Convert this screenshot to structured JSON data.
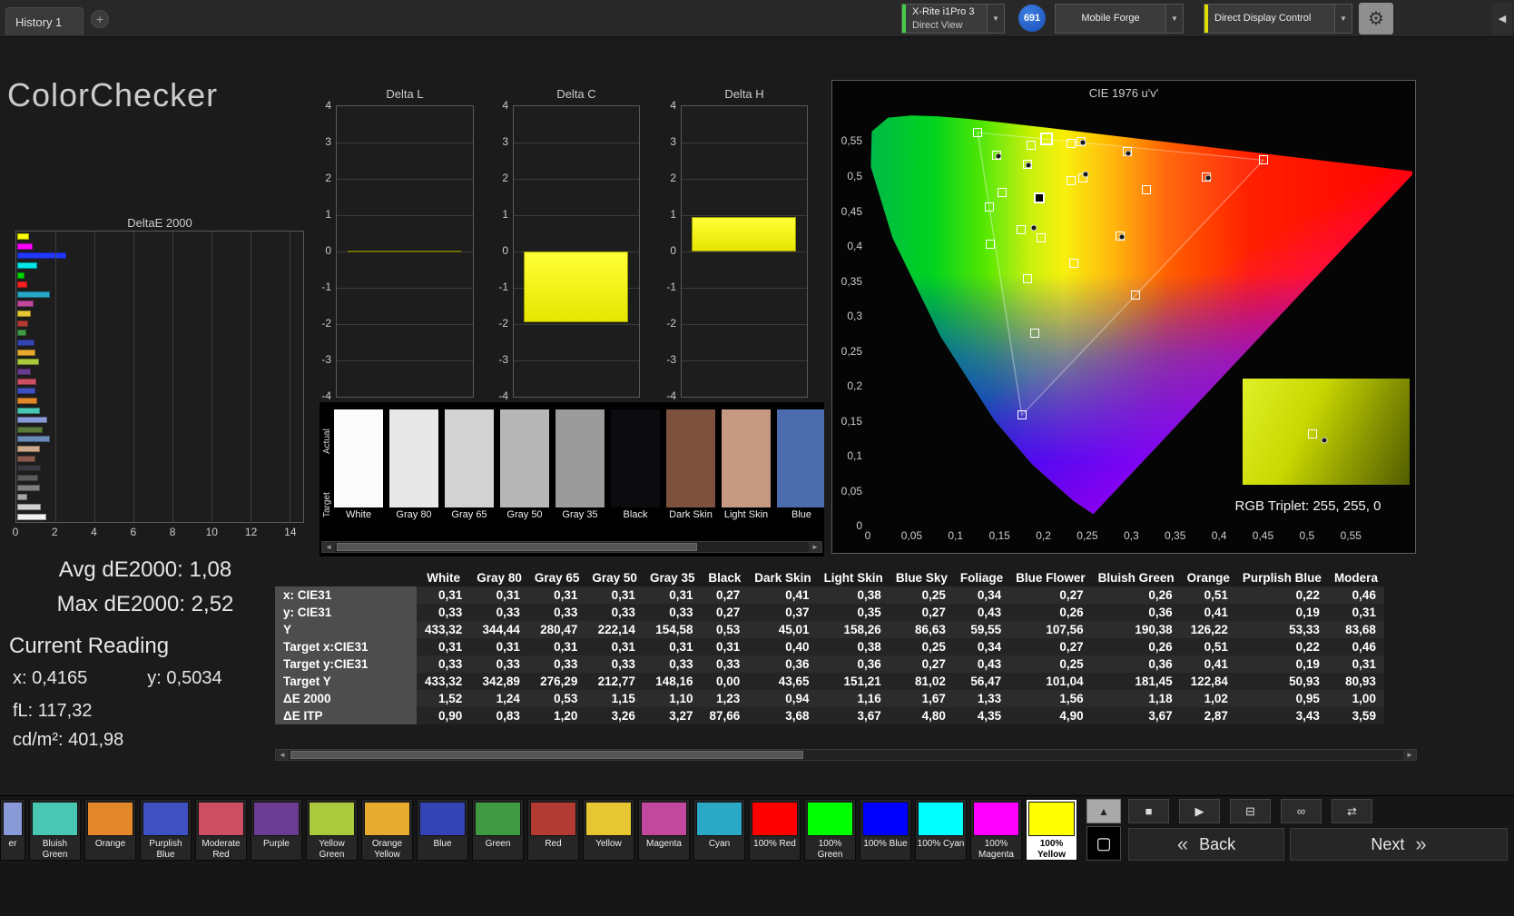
{
  "title": "ColorChecker",
  "icons": {
    "dropdown": "▼",
    "gear": "⚙",
    "collapse": "◀",
    "scroll_left": "◄",
    "scroll_right": "►",
    "up": "▲",
    "stop": "■",
    "play": "▶",
    "pattern": "⊟",
    "infinity": "∞",
    "loop": "⇄",
    "back_chev": "«",
    "next_chev": "»",
    "plus": "+",
    "square": "▢"
  },
  "colors": {
    "accent_green": "#44cc44",
    "accent_yellow": "#dddd00",
    "badge_blue": "#1f62d4",
    "bar_yellow": "#ffff00",
    "selected_patch_bg": "#ffffff"
  },
  "topbar": {
    "tab": "History 1",
    "meter_line1": "X-Rite i1Pro 3",
    "meter_line2": "Direct View",
    "badge": "691",
    "pattern_source": "Mobile Forge",
    "display_control": "Direct Display Control"
  },
  "stats": {
    "avg": "Avg dE2000: 1,08",
    "max": "Max dE2000: 2,52",
    "current": "Current Reading",
    "x": "x: 0,4165",
    "y": "y: 0,5034",
    "fl": "fL: 117,32",
    "cd": "cd/m²: 401,98"
  },
  "deltae_chart": {
    "title": "DeltaE 2000",
    "x_ticks": [
      0,
      2,
      4,
      6,
      8,
      10,
      12,
      14
    ],
    "xmax": 14.7,
    "bars": [
      {
        "c": "#ffff00",
        "v": 0.62
      },
      {
        "c": "#ff00ff",
        "v": 0.8
      },
      {
        "c": "#2038ff",
        "v": 2.52
      },
      {
        "c": "#00e8e8",
        "v": 1.02
      },
      {
        "c": "#00d800",
        "v": 0.38
      },
      {
        "c": "#ff2020",
        "v": 0.52
      },
      {
        "c": "#28a8c8",
        "v": 1.7
      },
      {
        "c": "#c2489e",
        "v": 0.85
      },
      {
        "c": "#e6c732",
        "v": 0.72
      },
      {
        "c": "#b23c34",
        "v": 0.58
      },
      {
        "c": "#3f9a43",
        "v": 0.48
      },
      {
        "c": "#3444b4",
        "v": 0.88
      },
      {
        "c": "#e7ab2f",
        "v": 0.95
      },
      {
        "c": "#abc93c",
        "v": 1.12
      },
      {
        "c": "#6b3d92",
        "v": 0.68
      },
      {
        "c": "#cc4f63",
        "v": 1.0
      },
      {
        "c": "#3f51c1",
        "v": 0.95
      },
      {
        "c": "#e2882a",
        "v": 1.02
      },
      {
        "c": "#49c7b2",
        "v": 1.18
      },
      {
        "c": "#8a9ad8",
        "v": 1.56
      },
      {
        "c": "#5a7a3a",
        "v": 1.33
      },
      {
        "c": "#6a8ab8",
        "v": 1.67
      },
      {
        "c": "#d0a98a",
        "v": 1.16
      },
      {
        "c": "#8a5a4a",
        "v": 0.94
      },
      {
        "c": "#3a3a42",
        "v": 1.23
      },
      {
        "c": "#5c5c5c",
        "v": 1.1
      },
      {
        "c": "#808080",
        "v": 1.15
      },
      {
        "c": "#a8a8a8",
        "v": 0.53
      },
      {
        "c": "#d0d0d0",
        "v": 1.24
      },
      {
        "c": "#f2f2f2",
        "v": 1.52
      }
    ]
  },
  "delta_axis": {
    "ticks": [
      4,
      3,
      2,
      1,
      0,
      -1,
      -2,
      -3,
      -4
    ]
  },
  "delta_charts": [
    {
      "title": "Delta L",
      "value": -0.04
    },
    {
      "title": "Delta C",
      "value": -1.95
    },
    {
      "title": "Delta H",
      "value": 0.95
    }
  ],
  "patch_strip": {
    "actual_label": "Actual",
    "target_label": "Target",
    "patches": [
      {
        "label": "White",
        "color": "#fbfbfb"
      },
      {
        "label": "Gray 80",
        "color": "#e8e8e8"
      },
      {
        "label": "Gray 65",
        "color": "#d2d2d2"
      },
      {
        "label": "Gray 50",
        "color": "#b7b7b7"
      },
      {
        "label": "Gray 35",
        "color": "#9b9b9b"
      },
      {
        "label": "Black",
        "color": "#0b0b10"
      },
      {
        "label": "Dark Skin",
        "color": "#7c523f"
      },
      {
        "label": "Light Skin",
        "color": "#c69a82"
      },
      {
        "label": "Blue",
        "color": "#4c6cae"
      }
    ]
  },
  "cie": {
    "title": "CIE 1976 u'v'",
    "umax": 0.62,
    "vmax": 0.6,
    "x_ticks": [
      "0",
      "0,05",
      "0,1",
      "0,15",
      "0,2",
      "0,25",
      "0,3",
      "0,35",
      "0,4",
      "0,45",
      "0,5",
      "0,55"
    ],
    "y_ticks": [
      "0",
      "0,05",
      "0,1",
      "0,15",
      "0,2",
      "0,25",
      "0,3",
      "0,35",
      "0,4",
      "0,45",
      "0,5",
      "0,55"
    ],
    "inset_label": "RGB Triplet: 255, 255, 0",
    "points": [
      {
        "u": 0.1956,
        "v": 0.4685,
        "k": "dark"
      },
      {
        "u": 0.2454,
        "v": 0.4969,
        "k": "sq"
      },
      {
        "u": 0.2317,
        "v": 0.4939,
        "k": "sq"
      },
      {
        "u": 0.1742,
        "v": 0.4233,
        "k": "sq"
      },
      {
        "u": 0.1818,
        "v": 0.5174,
        "k": "sq"
      },
      {
        "u": 0.1978,
        "v": 0.4121,
        "k": "sq"
      },
      {
        "u": 0.1529,
        "v": 0.4765,
        "k": "sq"
      },
      {
        "u": 0.2957,
        "v": 0.5348,
        "k": "sq"
      },
      {
        "u": 0.1818,
        "v": 0.3533,
        "k": "sq"
      },
      {
        "u": 0.3172,
        "v": 0.481,
        "k": "sq"
      },
      {
        "u": 0.2341,
        "v": 0.3749,
        "k": "sq"
      },
      {
        "u": 0.1862,
        "v": 0.544,
        "k": "sq"
      },
      {
        "u": 0.2314,
        "v": 0.5463,
        "k": "sq"
      },
      {
        "u": 0.19,
        "v": 0.2755,
        "k": "sq"
      },
      {
        "u": 0.147,
        "v": 0.5294,
        "k": "sq"
      },
      {
        "u": 0.3857,
        "v": 0.4988,
        "k": "sq"
      },
      {
        "u": 0.2428,
        "v": 0.5498,
        "k": "sq"
      },
      {
        "u": 0.2873,
        "v": 0.4138,
        "k": "sq"
      },
      {
        "u": 0.1392,
        "v": 0.4027,
        "k": "sq"
      },
      {
        "u": 0.4507,
        "v": 0.5229,
        "k": "sq"
      },
      {
        "u": 0.125,
        "v": 0.5625,
        "k": "sq"
      },
      {
        "u": 0.1754,
        "v": 0.1579,
        "k": "sq"
      },
      {
        "u": 0.1384,
        "v": 0.4555,
        "k": "sq"
      },
      {
        "u": 0.305,
        "v": 0.3298,
        "k": "sq"
      },
      {
        "u": 0.2039,
        "v": 0.5529,
        "k": "sel"
      },
      {
        "u": 0.1895,
        "v": 0.4263,
        "k": "dot"
      },
      {
        "u": 0.2477,
        "v": 0.503,
        "k": "dot"
      },
      {
        "u": 0.149,
        "v": 0.528,
        "k": "dot"
      },
      {
        "u": 0.2445,
        "v": 0.548,
        "k": "dot"
      },
      {
        "u": 0.388,
        "v": 0.4975,
        "k": "dot"
      },
      {
        "u": 0.297,
        "v": 0.533,
        "k": "dot"
      },
      {
        "u": 0.183,
        "v": 0.516,
        "k": "dot"
      },
      {
        "u": 0.289,
        "v": 0.4125,
        "k": "dot"
      }
    ]
  },
  "table": {
    "columns": [
      "",
      "White",
      "Gray 80",
      "Gray 65",
      "Gray 50",
      "Gray 35",
      "Black",
      "Dark Skin",
      "Light Skin",
      "Blue Sky",
      "Foliage",
      "Blue Flower",
      "Bluish Green",
      "Orange",
      "Purplish Blue",
      "Modera"
    ],
    "rows": [
      {
        "label": "x: CIE31",
        "values": [
          "0,31",
          "0,31",
          "0,31",
          "0,31",
          "0,31",
          "0,27",
          "0,41",
          "0,38",
          "0,25",
          "0,34",
          "0,27",
          "0,26",
          "0,51",
          "0,22",
          "0,46"
        ]
      },
      {
        "label": "y: CIE31",
        "values": [
          "0,33",
          "0,33",
          "0,33",
          "0,33",
          "0,33",
          "0,27",
          "0,37",
          "0,35",
          "0,27",
          "0,43",
          "0,26",
          "0,36",
          "0,41",
          "0,19",
          "0,31"
        ]
      },
      {
        "label": "Y",
        "values": [
          "433,32",
          "344,44",
          "280,47",
          "222,14",
          "154,58",
          "0,53",
          "45,01",
          "158,26",
          "86,63",
          "59,55",
          "107,56",
          "190,38",
          "126,22",
          "53,33",
          "83,68"
        ]
      },
      {
        "label": "Target x:CIE31",
        "values": [
          "0,31",
          "0,31",
          "0,31",
          "0,31",
          "0,31",
          "0,31",
          "0,40",
          "0,38",
          "0,25",
          "0,34",
          "0,27",
          "0,26",
          "0,51",
          "0,22",
          "0,46"
        ]
      },
      {
        "label": "Target y:CIE31",
        "values": [
          "0,33",
          "0,33",
          "0,33",
          "0,33",
          "0,33",
          "0,33",
          "0,36",
          "0,36",
          "0,27",
          "0,43",
          "0,25",
          "0,36",
          "0,41",
          "0,19",
          "0,31"
        ]
      },
      {
        "label": "Target Y",
        "values": [
          "433,32",
          "342,89",
          "276,29",
          "212,77",
          "148,16",
          "0,00",
          "43,65",
          "151,21",
          "81,02",
          "56,47",
          "101,04",
          "181,45",
          "122,84",
          "50,93",
          "80,93"
        ]
      },
      {
        "label": "ΔE 2000",
        "values": [
          "1,52",
          "1,24",
          "0,53",
          "1,15",
          "1,10",
          "1,23",
          "0,94",
          "1,16",
          "1,67",
          "1,33",
          "1,56",
          "1,18",
          "1,02",
          "0,95",
          "1,00"
        ]
      },
      {
        "label": "ΔE ITP",
        "values": [
          "0,90",
          "0,83",
          "1,20",
          "3,26",
          "3,27",
          "87,66",
          "3,68",
          "3,67",
          "4,80",
          "4,35",
          "4,90",
          "3,67",
          "2,87",
          "3,43",
          "3,59"
        ]
      }
    ]
  },
  "bottombar": {
    "patches": [
      {
        "label": "er",
        "color": "#8a9ad8",
        "partial": true
      },
      {
        "label": "Bluish Green",
        "color": "#49c7b2"
      },
      {
        "label": "Orange",
        "color": "#e2882a"
      },
      {
        "label": "Purplish Blue",
        "color": "#3f51c1"
      },
      {
        "label": "Moderate Red",
        "color": "#cc4f63"
      },
      {
        "label": "Purple",
        "color": "#6b3d92"
      },
      {
        "label": "Yellow Green",
        "color": "#abc93c"
      },
      {
        "label": "Orange Yellow",
        "color": "#e7ab2f"
      },
      {
        "label": "Blue",
        "color": "#3444b4"
      },
      {
        "label": "Green",
        "color": "#3f9a43"
      },
      {
        "label": "Red",
        "color": "#b23c34"
      },
      {
        "label": "Yellow",
        "color": "#e6c732"
      },
      {
        "label": "Magenta",
        "color": "#c2489e"
      },
      {
        "label": "Cyan",
        "color": "#2aa8c6"
      },
      {
        "label": "100% Red",
        "color": "#ff0000"
      },
      {
        "label": "100% Green",
        "color": "#00ff00"
      },
      {
        "label": "100% Blue",
        "color": "#0000ff"
      },
      {
        "label": "100% Cyan",
        "color": "#00ffff"
      },
      {
        "label": "100% Magenta",
        "color": "#ff00ff"
      },
      {
        "label": "100% Yellow",
        "color": "#ffff00",
        "selected": true
      }
    ],
    "back": "Back",
    "next": "Next"
  }
}
